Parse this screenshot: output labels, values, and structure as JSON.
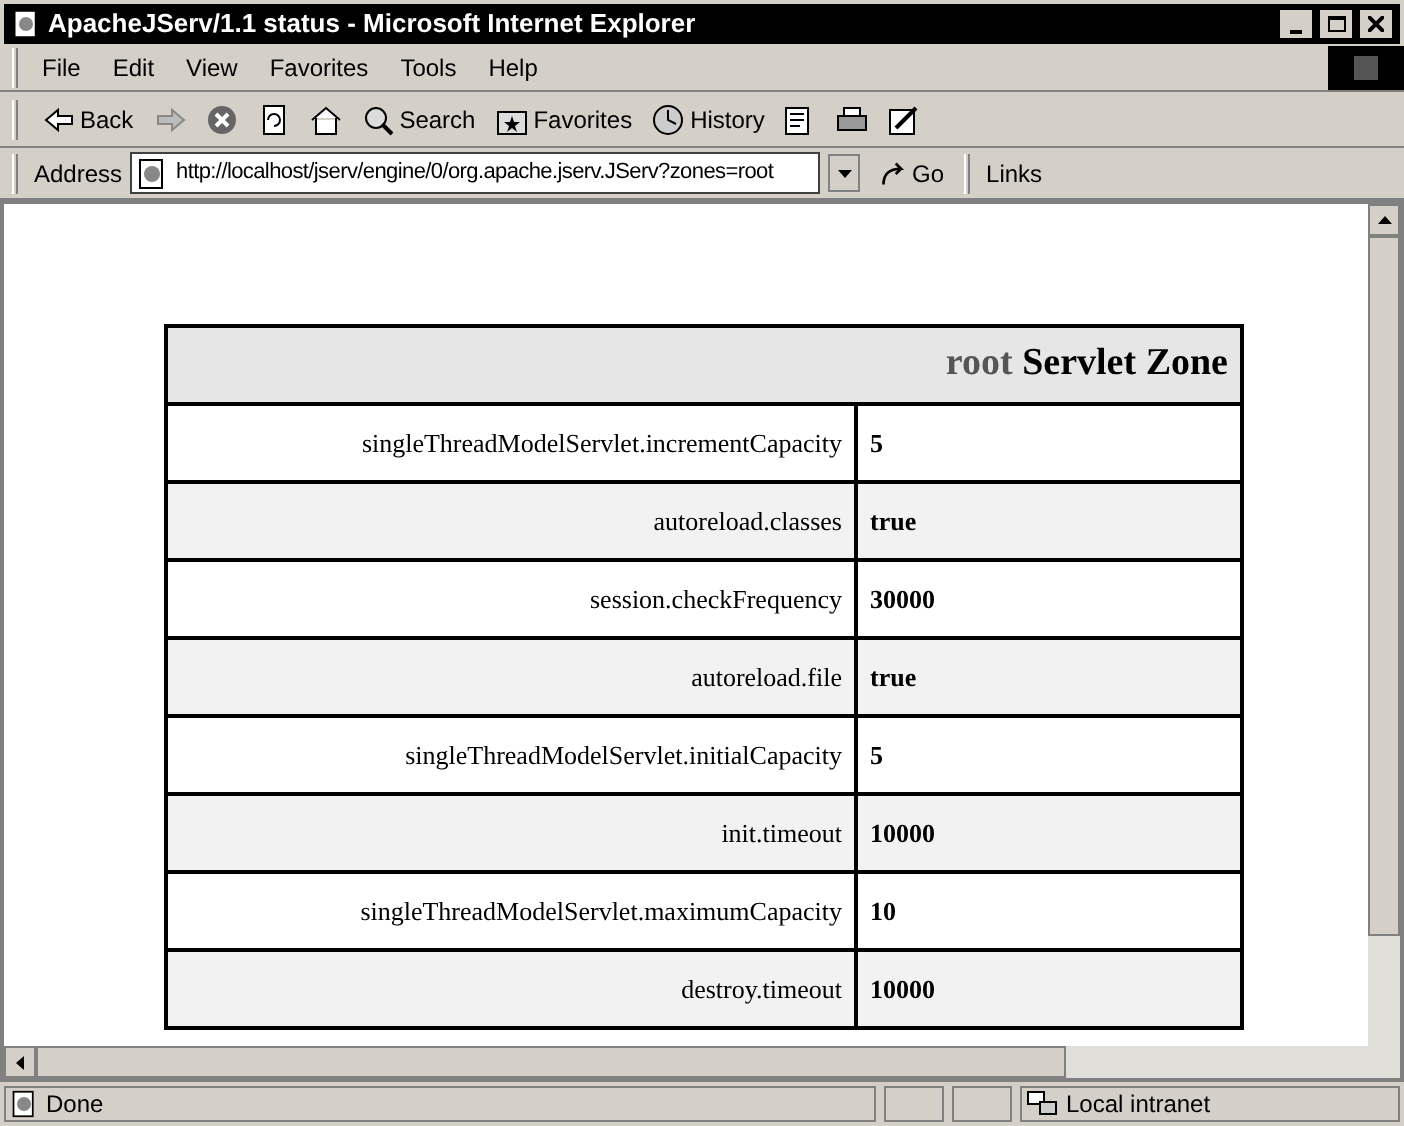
{
  "window": {
    "title": "ApacheJServ/1.1 status - Microsoft Internet Explorer"
  },
  "menu": [
    "File",
    "Edit",
    "View",
    "Favorites",
    "Tools",
    "Help"
  ],
  "toolbar": [
    {
      "kind": "back",
      "label": "Back"
    },
    {
      "kind": "forward"
    },
    {
      "kind": "stop"
    },
    {
      "kind": "refresh"
    },
    {
      "kind": "home"
    },
    {
      "kind": "search",
      "label": "Search"
    },
    {
      "kind": "favorites",
      "label": "Favorites"
    },
    {
      "kind": "history",
      "label": "History"
    },
    {
      "kind": "mail"
    },
    {
      "kind": "print"
    },
    {
      "kind": "edit"
    }
  ],
  "address": {
    "label": "Address",
    "value": "http://localhost/jserv/engine/0/org.apache.jserv.JServ?zones=root",
    "go": "Go",
    "links": "Links"
  },
  "table": {
    "title_zone": "root",
    "title_rest": "Servlet Zone",
    "rows": [
      {
        "name": "singleThreadModelServlet.incrementCapacity",
        "value": "5"
      },
      {
        "name": "autoreload.classes",
        "value": "true"
      },
      {
        "name": "session.checkFrequency",
        "value": "30000"
      },
      {
        "name": "autoreload.file",
        "value": "true"
      },
      {
        "name": "singleThreadModelServlet.initialCapacity",
        "value": "5"
      },
      {
        "name": "init.timeout",
        "value": "10000"
      },
      {
        "name": "singleThreadModelServlet.maximumCapacity",
        "value": "10"
      },
      {
        "name": "destroy.timeout",
        "value": "10000"
      }
    ]
  },
  "status_bar": {
    "text": "Done",
    "zone": "Local intranet"
  }
}
